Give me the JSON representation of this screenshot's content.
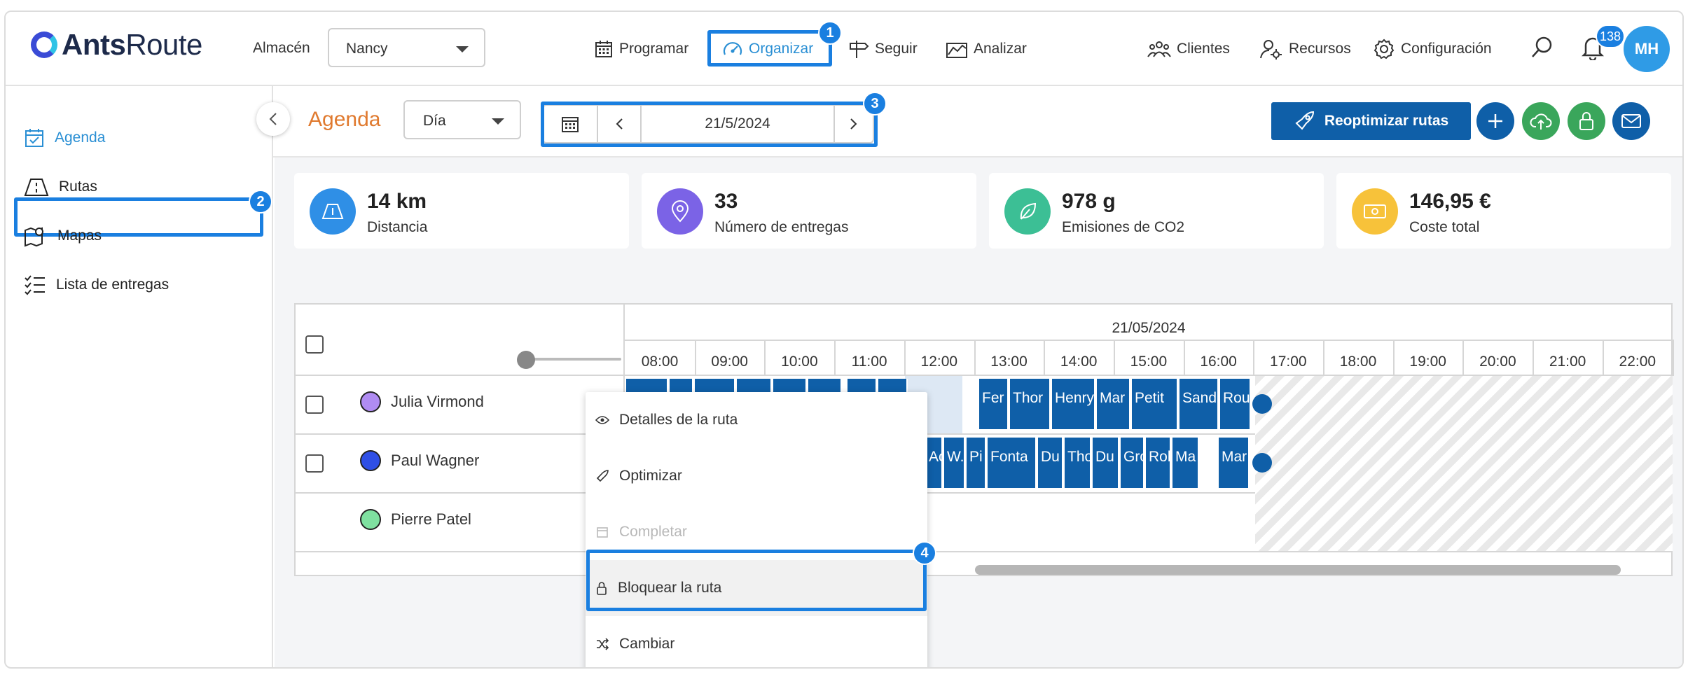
{
  "app": {
    "logo_bold": "Ants",
    "logo_rest": "Route"
  },
  "header": {
    "warehouse_label": "Almacén",
    "warehouse_value": "Nancy",
    "nav": {
      "programar": "Programar",
      "organizar": "Organizar",
      "seguir": "Seguir",
      "analizar": "Analizar",
      "clientes": "Clientes",
      "recursos": "Recursos",
      "configuracion": "Configuración"
    },
    "notification_count": "138",
    "avatar_initials": "MH"
  },
  "sidebar": {
    "items": [
      {
        "label": "Agenda",
        "icon": "calendar-check-icon"
      },
      {
        "label": "Rutas",
        "icon": "road-icon"
      },
      {
        "label": "Mapas",
        "icon": "map-pin-icon"
      },
      {
        "label": "Lista de entregas",
        "icon": "checklist-icon"
      }
    ]
  },
  "toolbar": {
    "title": "Agenda",
    "view_value": "Día",
    "date_value": "21/5/2024",
    "reoptimize_label": "Reoptimizar rutas"
  },
  "kpis": [
    {
      "value": "14 km",
      "label": "Distancia",
      "color": "#2f8fe6"
    },
    {
      "value": "33",
      "label": "Número de entregas",
      "color": "#7b63e6"
    },
    {
      "value": "978 g",
      "label": "Emisiones de CO2",
      "color": "#3cbf95"
    },
    {
      "value": "146,95 €",
      "label": "Coste total",
      "color": "#f7c23a"
    }
  ],
  "planner": {
    "date_header": "21/05/2024",
    "hours": [
      "08:00",
      "09:00",
      "10:00",
      "11:00",
      "12:00",
      "13:00",
      "14:00",
      "15:00",
      "16:00",
      "17:00",
      "18:00",
      "19:00",
      "20:00",
      "21:00",
      "22:00"
    ],
    "rows": [
      {
        "name": "Julia Virmond",
        "color": "#b08cf2"
      },
      {
        "name": "Paul Wagner",
        "color": "#2f4fe6"
      },
      {
        "name": "Pierre Patel",
        "color": "#7fe0a0"
      }
    ],
    "row1_tasks": [
      "Fer",
      "Thor",
      "Henry",
      "Mar",
      "Petit",
      "Sand",
      "Rou"
    ],
    "row2_tasks": [
      "Ac",
      "W.",
      "Pi",
      "Fonta",
      "Du",
      "Tho",
      "Du",
      "Gro",
      "Rol",
      "Ma",
      "Mar"
    ]
  },
  "context_menu": {
    "items": [
      {
        "label": "Detalles de la ruta",
        "icon": "eye-icon"
      },
      {
        "label": "Optimizar",
        "icon": "rocket-icon"
      },
      {
        "label": "Completar",
        "icon": "calendar-icon"
      },
      {
        "label": "Bloquear la ruta",
        "icon": "lock-icon"
      },
      {
        "label": "Cambiar",
        "icon": "shuffle-icon"
      }
    ]
  },
  "callouts": [
    "1",
    "2",
    "3",
    "4"
  ]
}
